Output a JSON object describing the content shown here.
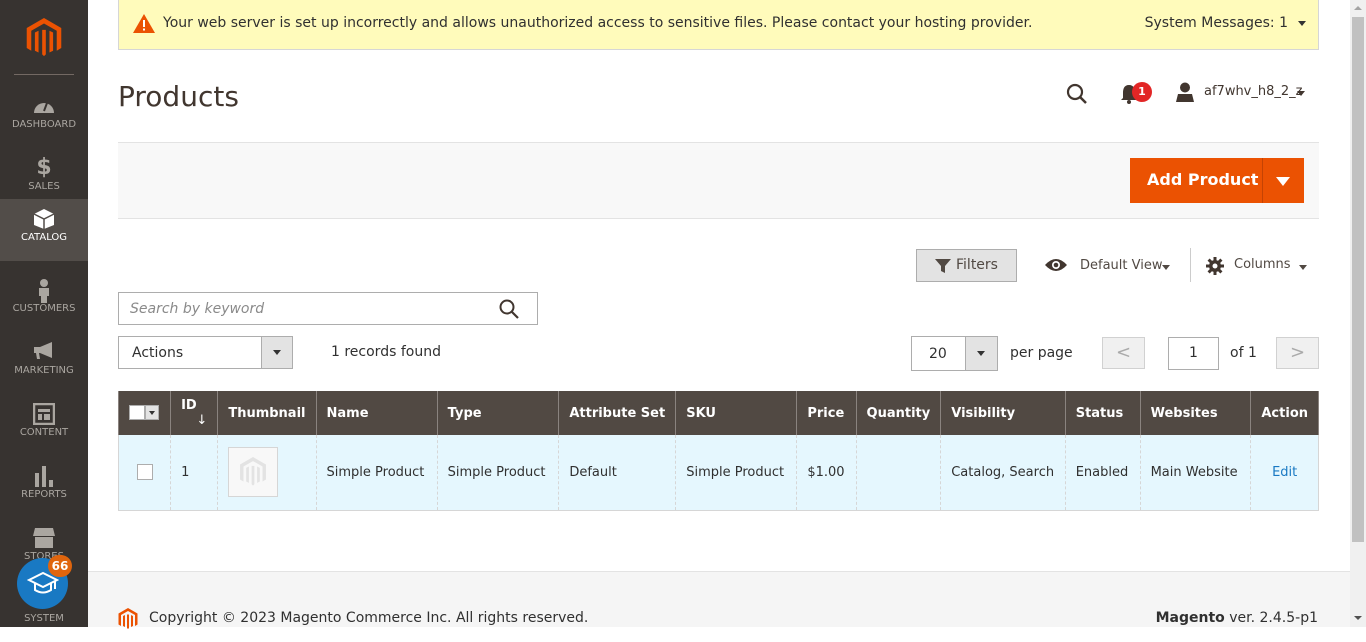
{
  "sidebar": {
    "items": [
      {
        "label": "DASHBOARD",
        "icon": "dashboard-icon"
      },
      {
        "label": "SALES",
        "icon": "dollar-icon"
      },
      {
        "label": "CATALOG",
        "icon": "box-icon",
        "active": true
      },
      {
        "label": "CUSTOMERS",
        "icon": "person-icon"
      },
      {
        "label": "MARKETING",
        "icon": "megaphone-icon"
      },
      {
        "label": "CONTENT",
        "icon": "layout-icon"
      },
      {
        "label": "REPORTS",
        "icon": "bar-chart-icon"
      },
      {
        "label": "STORES",
        "icon": "store-icon"
      },
      {
        "label": "SYSTEM",
        "icon": "gear-icon"
      }
    ],
    "learning_badge": "66"
  },
  "system_message": {
    "text": "Your web server is set up incorrectly and allows unauthorized access to sensitive files. Please contact your hosting provider.",
    "count_label": "System Messages: 1"
  },
  "header": {
    "title": "Products",
    "notifications_count": "1",
    "username": "af7whv_h8_2_z"
  },
  "toolbar": {
    "add_product_label": "Add Product",
    "filters_label": "Filters",
    "view_label": "Default View",
    "columns_label": "Columns"
  },
  "search": {
    "placeholder": "Search by keyword",
    "value": ""
  },
  "mass_actions": {
    "label": "Actions",
    "records_found": "1 records found"
  },
  "pagination": {
    "per_page": "20",
    "per_page_label": "per page",
    "current_page": "1",
    "of_label": "of 1",
    "prev": "<",
    "next": ">"
  },
  "grid": {
    "columns": [
      "ID",
      "Thumbnail",
      "Name",
      "Type",
      "Attribute Set",
      "SKU",
      "Price",
      "Quantity",
      "Visibility",
      "Status",
      "Websites",
      "Action"
    ],
    "sort_indicator": "↓",
    "rows": [
      {
        "id": "1",
        "name": "Simple Product",
        "type": "Simple Product",
        "attribute_set": "Default",
        "sku": "Simple Product",
        "price": "$1.00",
        "quantity": "",
        "visibility": "Catalog, Search",
        "status": "Enabled",
        "websites": "Main Website",
        "action": "Edit"
      }
    ]
  },
  "footer": {
    "copyright": "Copyright © 2023 Magento Commerce Inc. All rights reserved.",
    "brand": "Magento",
    "version": "ver. 2.4.5-p1"
  },
  "colors": {
    "sidebar_bg": "#373330",
    "accent": "#eb5202",
    "grid_header": "#514943",
    "row_highlight": "#e5f7fe",
    "link": "#1979c3",
    "message_bg": "#fffbbb"
  }
}
